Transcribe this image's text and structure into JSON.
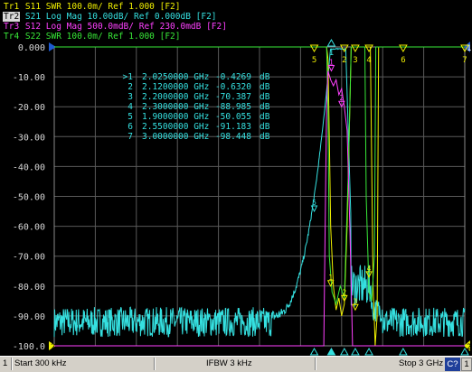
{
  "colors": {
    "background": "#000000",
    "grid": "#5a5a5a",
    "trace1": "#f0f000",
    "trace2": "#35e0e0",
    "trace3": "#ff40ff",
    "trace4": "#38e838",
    "statusbar": "#d4d0c8"
  },
  "traces": [
    {
      "id": "Tr1",
      "param": "S11",
      "format": "SWR",
      "scale": "100.0m/",
      "ref": "Ref 1.000",
      "tag": "[F2]",
      "color": "#f0f000",
      "active": false
    },
    {
      "id": "Tr2",
      "param": "S21",
      "format": "Log Mag",
      "scale": "10.00dB/",
      "ref": "Ref 0.000dB",
      "tag": "[F2]",
      "color": "#35e0e0",
      "active": true
    },
    {
      "id": "Tr3",
      "param": "S12",
      "format": "Log Mag",
      "scale": "500.0mdB/",
      "ref": "Ref 230.0mdB",
      "tag": "[F2]",
      "color": "#ff40ff",
      "active": false
    },
    {
      "id": "Tr4",
      "param": "S22",
      "format": "SWR",
      "scale": "100.0m/",
      "ref": "Ref 1.000",
      "tag": "[F2]",
      "color": "#38e838",
      "active": false
    }
  ],
  "y_axis_labels": [
    "0.000",
    "-10.00",
    "-20.00",
    "-30.00",
    "-40.00",
    "-50.00",
    "-60.00",
    "-70.00",
    "-80.00",
    "-90.00",
    "-100.0"
  ],
  "markers": [
    {
      "num": ">1",
      "freq": "2.0250000 GHz",
      "value": "-0.4269",
      "unit": "dB"
    },
    {
      "num": "2",
      "freq": "2.1200000 GHz",
      "value": "-0.6320",
      "unit": "dB"
    },
    {
      "num": "3",
      "freq": "2.2000000 GHz",
      "value": "-70.387",
      "unit": "dB"
    },
    {
      "num": "4",
      "freq": "2.3000000 GHz",
      "value": "-88.985",
      "unit": "dB"
    },
    {
      "num": "5",
      "freq": "1.9000000 GHz",
      "value": "-50.055",
      "unit": "dB"
    },
    {
      "num": "6",
      "freq": "2.5500000 GHz",
      "value": "-91.183",
      "unit": "dB"
    },
    {
      "num": "7",
      "freq": "3.0000000 GHz",
      "value": "-98.448",
      "unit": "dB"
    }
  ],
  "top_marker_labels": [
    "1",
    "5",
    "2",
    "3",
    "4",
    "6",
    "7"
  ],
  "right_edge_labels": [
    "1",
    "2"
  ],
  "left_edge_label": "2",
  "status": {
    "channel": "1",
    "start": "Start 300 kHz",
    "ifbw": "IFBW 3 kHz",
    "stop": "Stop 3 GHz",
    "cal": "C?",
    "num": "1"
  }
}
